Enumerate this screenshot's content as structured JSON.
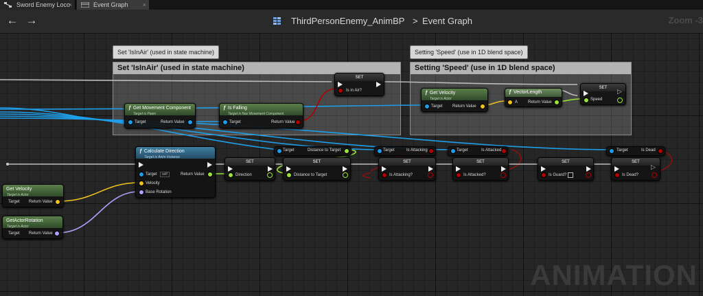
{
  "tabs": [
    {
      "label": "Sword Enemy Loco",
      "close": "×"
    },
    {
      "label": "Event Graph",
      "close": "×"
    }
  ],
  "header": {
    "back_icon": "←",
    "fwd_icon": "→",
    "blueprint": "ThirdPersonEnemy_AnimBP",
    "separator": ">",
    "graph": "Event Graph",
    "zoom": "Zoom -3"
  },
  "comments": [
    {
      "bubble": "Set 'IsInAir' (used in state machine)",
      "title": "Set 'IsInAir' (used in state machine)"
    },
    {
      "bubble": "Setting 'Speed' (use in 1D blend space)",
      "title": "Setting 'Speed' (use in 1D blend space)"
    }
  ],
  "nodes": {
    "set_inair": {
      "title": "SET",
      "pin": "Is in Air?"
    },
    "get_move": {
      "title": "Get Movement Component",
      "sub": "Target is Pawn",
      "in": "Target",
      "out": "Return Value"
    },
    "is_falling": {
      "title": "Is Falling",
      "sub": "Target is Nav Movement Component",
      "in": "Target",
      "out": "Return Value"
    },
    "get_vel1": {
      "title": "Get Velocity",
      "sub": "Target is Actor",
      "in": "Target",
      "out": "Return Value"
    },
    "vec_len": {
      "title": "VectorLength",
      "in": "A",
      "out": "Return Value"
    },
    "set_speed": {
      "title": "SET",
      "pin": "Speed"
    },
    "calc_dir": {
      "title": "Calculate Direction",
      "sub": "Target is Anim Instance",
      "target": "Target",
      "self": "self",
      "velocity": "Velocity",
      "base_rot": "Base Rotation",
      "out": "Return Value"
    },
    "set_dir": {
      "title": "SET",
      "pin": "Direction"
    },
    "set_dist": {
      "title": "SET",
      "pin": "Distance to Target"
    },
    "get_dist": {
      "target": "Target",
      "out": "Distance to Target"
    },
    "get_attacking": {
      "target": "Target",
      "out": "Is Attacking"
    },
    "set_attacking": {
      "title": "SET",
      "pin": "Is Attacking?"
    },
    "get_attacked": {
      "target": "Target",
      "out": "Is Attacked"
    },
    "set_attacked": {
      "title": "SET",
      "pin": "Is Attacked?"
    },
    "set_guard": {
      "title": "SET",
      "pin": "Is Guard?"
    },
    "get_dead": {
      "target": "Target",
      "out": "Is Dead"
    },
    "set_dead": {
      "title": "SET",
      "pin": "Is Dead?"
    },
    "get_vel2": {
      "title": "Get Velocity",
      "sub": "Target is Actor",
      "in": "Target",
      "out": "Return Value"
    },
    "get_rot": {
      "title": "GetActorRotation",
      "sub": "Target is Actor",
      "in": "Target",
      "out": "Return Value"
    }
  },
  "watermark": "ANIMATION",
  "colors": {
    "object_pin": "#1e9ee9",
    "bool_pin": "#b00000",
    "vector_pin": "#f0c31a",
    "float_pin": "#9be33a",
    "rotator_pin": "#b0a0ff",
    "function_header": "#5a7f4a",
    "blueprint_graph_bg": "#262626"
  }
}
